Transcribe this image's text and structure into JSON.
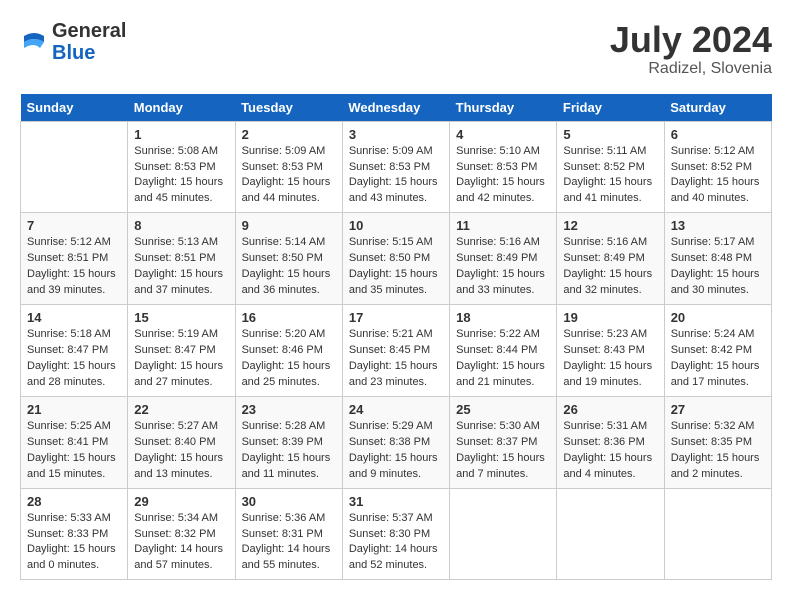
{
  "header": {
    "logo_general": "General",
    "logo_blue": "Blue",
    "month_title": "July 2024",
    "location": "Radizel, Slovenia"
  },
  "days_of_week": [
    "Sunday",
    "Monday",
    "Tuesday",
    "Wednesday",
    "Thursday",
    "Friday",
    "Saturday"
  ],
  "weeks": [
    [
      {
        "day": "",
        "info": ""
      },
      {
        "day": "1",
        "info": "Sunrise: 5:08 AM\nSunset: 8:53 PM\nDaylight: 15 hours\nand 45 minutes."
      },
      {
        "day": "2",
        "info": "Sunrise: 5:09 AM\nSunset: 8:53 PM\nDaylight: 15 hours\nand 44 minutes."
      },
      {
        "day": "3",
        "info": "Sunrise: 5:09 AM\nSunset: 8:53 PM\nDaylight: 15 hours\nand 43 minutes."
      },
      {
        "day": "4",
        "info": "Sunrise: 5:10 AM\nSunset: 8:53 PM\nDaylight: 15 hours\nand 42 minutes."
      },
      {
        "day": "5",
        "info": "Sunrise: 5:11 AM\nSunset: 8:52 PM\nDaylight: 15 hours\nand 41 minutes."
      },
      {
        "day": "6",
        "info": "Sunrise: 5:12 AM\nSunset: 8:52 PM\nDaylight: 15 hours\nand 40 minutes."
      }
    ],
    [
      {
        "day": "7",
        "info": "Sunrise: 5:12 AM\nSunset: 8:51 PM\nDaylight: 15 hours\nand 39 minutes."
      },
      {
        "day": "8",
        "info": "Sunrise: 5:13 AM\nSunset: 8:51 PM\nDaylight: 15 hours\nand 37 minutes."
      },
      {
        "day": "9",
        "info": "Sunrise: 5:14 AM\nSunset: 8:50 PM\nDaylight: 15 hours\nand 36 minutes."
      },
      {
        "day": "10",
        "info": "Sunrise: 5:15 AM\nSunset: 8:50 PM\nDaylight: 15 hours\nand 35 minutes."
      },
      {
        "day": "11",
        "info": "Sunrise: 5:16 AM\nSunset: 8:49 PM\nDaylight: 15 hours\nand 33 minutes."
      },
      {
        "day": "12",
        "info": "Sunrise: 5:16 AM\nSunset: 8:49 PM\nDaylight: 15 hours\nand 32 minutes."
      },
      {
        "day": "13",
        "info": "Sunrise: 5:17 AM\nSunset: 8:48 PM\nDaylight: 15 hours\nand 30 minutes."
      }
    ],
    [
      {
        "day": "14",
        "info": "Sunrise: 5:18 AM\nSunset: 8:47 PM\nDaylight: 15 hours\nand 28 minutes."
      },
      {
        "day": "15",
        "info": "Sunrise: 5:19 AM\nSunset: 8:47 PM\nDaylight: 15 hours\nand 27 minutes."
      },
      {
        "day": "16",
        "info": "Sunrise: 5:20 AM\nSunset: 8:46 PM\nDaylight: 15 hours\nand 25 minutes."
      },
      {
        "day": "17",
        "info": "Sunrise: 5:21 AM\nSunset: 8:45 PM\nDaylight: 15 hours\nand 23 minutes."
      },
      {
        "day": "18",
        "info": "Sunrise: 5:22 AM\nSunset: 8:44 PM\nDaylight: 15 hours\nand 21 minutes."
      },
      {
        "day": "19",
        "info": "Sunrise: 5:23 AM\nSunset: 8:43 PM\nDaylight: 15 hours\nand 19 minutes."
      },
      {
        "day": "20",
        "info": "Sunrise: 5:24 AM\nSunset: 8:42 PM\nDaylight: 15 hours\nand 17 minutes."
      }
    ],
    [
      {
        "day": "21",
        "info": "Sunrise: 5:25 AM\nSunset: 8:41 PM\nDaylight: 15 hours\nand 15 minutes."
      },
      {
        "day": "22",
        "info": "Sunrise: 5:27 AM\nSunset: 8:40 PM\nDaylight: 15 hours\nand 13 minutes."
      },
      {
        "day": "23",
        "info": "Sunrise: 5:28 AM\nSunset: 8:39 PM\nDaylight: 15 hours\nand 11 minutes."
      },
      {
        "day": "24",
        "info": "Sunrise: 5:29 AM\nSunset: 8:38 PM\nDaylight: 15 hours\nand 9 minutes."
      },
      {
        "day": "25",
        "info": "Sunrise: 5:30 AM\nSunset: 8:37 PM\nDaylight: 15 hours\nand 7 minutes."
      },
      {
        "day": "26",
        "info": "Sunrise: 5:31 AM\nSunset: 8:36 PM\nDaylight: 15 hours\nand 4 minutes."
      },
      {
        "day": "27",
        "info": "Sunrise: 5:32 AM\nSunset: 8:35 PM\nDaylight: 15 hours\nand 2 minutes."
      }
    ],
    [
      {
        "day": "28",
        "info": "Sunrise: 5:33 AM\nSunset: 8:33 PM\nDaylight: 15 hours\nand 0 minutes."
      },
      {
        "day": "29",
        "info": "Sunrise: 5:34 AM\nSunset: 8:32 PM\nDaylight: 14 hours\nand 57 minutes."
      },
      {
        "day": "30",
        "info": "Sunrise: 5:36 AM\nSunset: 8:31 PM\nDaylight: 14 hours\nand 55 minutes."
      },
      {
        "day": "31",
        "info": "Sunrise: 5:37 AM\nSunset: 8:30 PM\nDaylight: 14 hours\nand 52 minutes."
      },
      {
        "day": "",
        "info": ""
      },
      {
        "day": "",
        "info": ""
      },
      {
        "day": "",
        "info": ""
      }
    ]
  ]
}
